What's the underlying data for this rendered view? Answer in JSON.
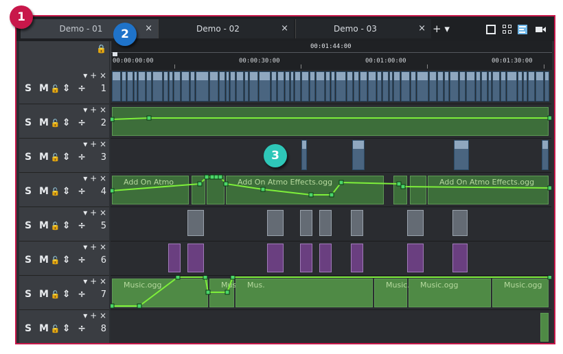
{
  "badges": {
    "one": "1",
    "two": "2",
    "three": "3"
  },
  "tabs": [
    {
      "label": "Demo - 01",
      "close": "×"
    },
    {
      "label": "Demo - 02",
      "close": "×"
    },
    {
      "label": "Demo - 03",
      "close": "×"
    }
  ],
  "tab_add": "+ ▾",
  "view_icons": [
    "single-monitor-icon",
    "grid-view-icon",
    "timeline-tracks-icon",
    "camera-icon"
  ],
  "ruler": {
    "timecode": "00:01:44:00",
    "ticks": [
      "00:00:00:00",
      "00:00:30:00",
      "00:01:00:00",
      "00:01:30:00"
    ]
  },
  "track_controls": {
    "solo": "S",
    "mute": "M",
    "lock": "🔒",
    "more": "⇕ ÷",
    "top_buttons": "▾ + ×"
  },
  "tracks": [
    {
      "number": "1",
      "type": "video"
    },
    {
      "number": "2",
      "type": "audio"
    },
    {
      "number": "3",
      "type": "video"
    },
    {
      "number": "4",
      "type": "audio"
    },
    {
      "number": "5",
      "type": "title"
    },
    {
      "number": "6",
      "type": "effect"
    },
    {
      "number": "7",
      "type": "audio"
    },
    {
      "number": "8",
      "type": "video"
    }
  ],
  "clip_labels": {
    "atmo1": "Add On Atmo",
    "atmo2": "Add On Atmo Effects.ogg",
    "atmo3": "Add On Atmo Effects.ogg",
    "music1": "Music.ogg",
    "music2": "Musi",
    "music3": "Mus.",
    "music4": "Music.",
    "music5": "Music.ogg",
    "music6": "Music.ogg"
  },
  "colors": {
    "frame": "#c8174a",
    "tab_highlight": "#1f73c9",
    "area": "#3fb8c8",
    "audio": "#3d6e3a",
    "envelope": "#7ef03a"
  }
}
